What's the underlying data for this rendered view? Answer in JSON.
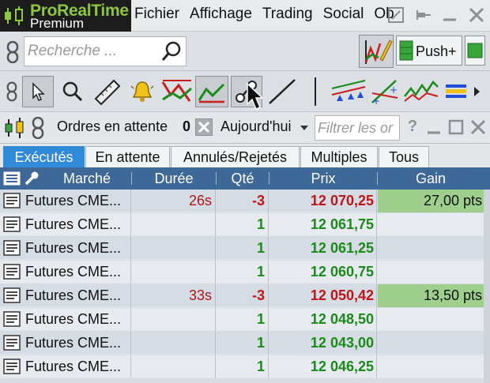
{
  "app": {
    "title": "ProRealTime",
    "subtitle": "Premium"
  },
  "menu": [
    "Fichier",
    "Affichage",
    "Trading",
    "Social",
    "Ob"
  ],
  "search": {
    "placeholder": "Recherche ..."
  },
  "toolbar": {
    "push_label": "Push+"
  },
  "panel": {
    "title": "Ordres en attente",
    "count": "0",
    "period": "Aujourd'hui",
    "filter_placeholder": "Filtrer les or",
    "help": "?"
  },
  "tabs": [
    {
      "label": "Exécutés",
      "active": true
    },
    {
      "label": "En attente",
      "active": false
    },
    {
      "label": "Annulés/Rejetés",
      "active": false
    },
    {
      "label": "Multiples",
      "active": false
    },
    {
      "label": "Tous",
      "active": false
    }
  ],
  "columns": {
    "market": "Marché",
    "duration": "Durée",
    "qty": "Qté",
    "price": "Prix",
    "gain": "Gain"
  },
  "rows": [
    {
      "market": "Futures CME...",
      "duration": "26s",
      "qty": "-3",
      "price": "12 070,25",
      "gain": "27,00 pts",
      "side": "sell"
    },
    {
      "market": "Futures CME...",
      "duration": "",
      "qty": "1",
      "price": "12 061,75",
      "gain": "",
      "side": "buy"
    },
    {
      "market": "Futures CME...",
      "duration": "",
      "qty": "1",
      "price": "12 061,25",
      "gain": "",
      "side": "buy"
    },
    {
      "market": "Futures CME...",
      "duration": "",
      "qty": "1",
      "price": "12 060,75",
      "gain": "",
      "side": "buy"
    },
    {
      "market": "Futures CME...",
      "duration": "33s",
      "qty": "-3",
      "price": "12 050,42",
      "gain": "13,50 pts",
      "side": "sell"
    },
    {
      "market": "Futures CME...",
      "duration": "",
      "qty": "1",
      "price": "12 048,50",
      "gain": "",
      "side": "buy"
    },
    {
      "market": "Futures CME...",
      "duration": "",
      "qty": "1",
      "price": "12 043,00",
      "gain": "",
      "side": "buy"
    },
    {
      "market": "Futures CME...",
      "duration": "",
      "qty": "1",
      "price": "12 046,25",
      "gain": "",
      "side": "buy"
    }
  ],
  "colors": {
    "tab_active": "#2f8ad8",
    "header": "#3d6897",
    "sell": "#c0141b",
    "buy": "#1a8a1a",
    "gain_bg": "#9fcf8c",
    "brand": "#8dc63f"
  }
}
